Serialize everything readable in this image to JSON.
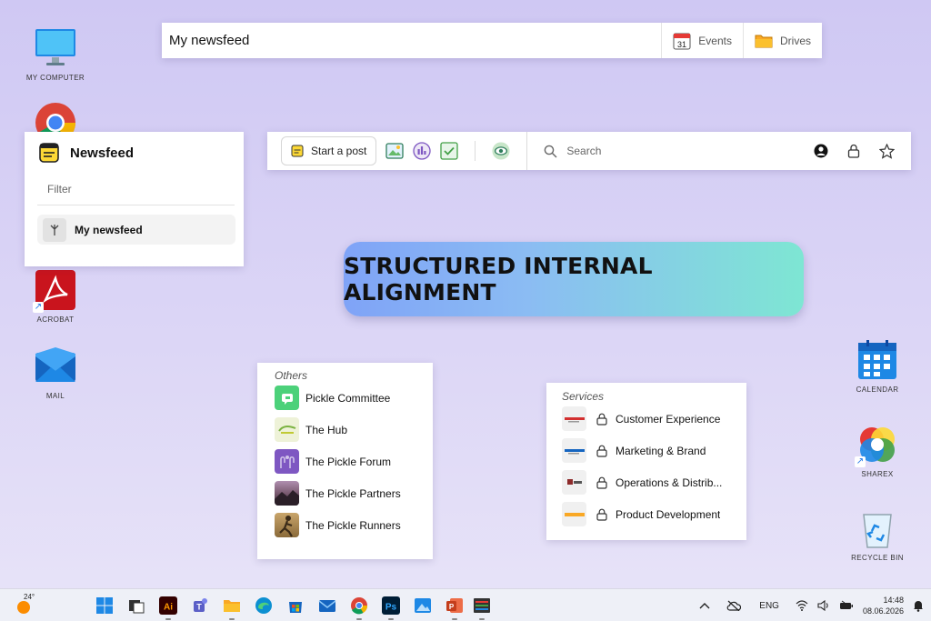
{
  "desktop_icons": [
    {
      "id": "my-computer",
      "label": "MY COMPUTER"
    },
    {
      "id": "acrobat",
      "label": "ACROBAT"
    },
    {
      "id": "mail",
      "label": "MAIL"
    },
    {
      "id": "calendar",
      "label": "CALENDAR"
    },
    {
      "id": "sharex",
      "label": "SHAREX"
    },
    {
      "id": "recycle-bin",
      "label": "RECYCLE BIN"
    }
  ],
  "topbar": {
    "title": "My newsfeed",
    "events_label": "Events",
    "events_icon": "calendar-31-icon",
    "calendar_number": "31",
    "drives_label": "Drives",
    "drives_icon": "folder-icon"
  },
  "newsfeed_panel": {
    "title": "Newsfeed",
    "filter_label": "Filter",
    "item_label": "My newsfeed"
  },
  "postbar": {
    "start_post_label": "Start a post",
    "search_placeholder": "Search",
    "tools": [
      "image-icon",
      "poll-icon",
      "checklist-icon",
      "eye-icon"
    ],
    "right_icons": [
      "user-icon",
      "lock-icon",
      "star-icon"
    ]
  },
  "banner": {
    "text": "STRUCTURED INTERNAL ALIGNMENT"
  },
  "others": {
    "section_title": "Others",
    "items": [
      {
        "label": "Pickle Committee"
      },
      {
        "label": "The Hub"
      },
      {
        "label": "The Pickle Forum"
      },
      {
        "label": "The Pickle Partners"
      },
      {
        "label": "The Pickle Runners"
      }
    ]
  },
  "services": {
    "section_title": "Services",
    "items": [
      {
        "label": "Customer Experience"
      },
      {
        "label": "Marketing & Brand"
      },
      {
        "label": "Operations & Distrib..."
      },
      {
        "label": "Product Development"
      }
    ]
  },
  "taskbar": {
    "weather_temp": "24°",
    "language": "ENG",
    "time": "14:48",
    "date": "08.06.2026"
  },
  "colors": {
    "accent_green": "#2e7d5b",
    "banner_start": "#7fa3f7",
    "banner_end": "#7ee6d3"
  }
}
